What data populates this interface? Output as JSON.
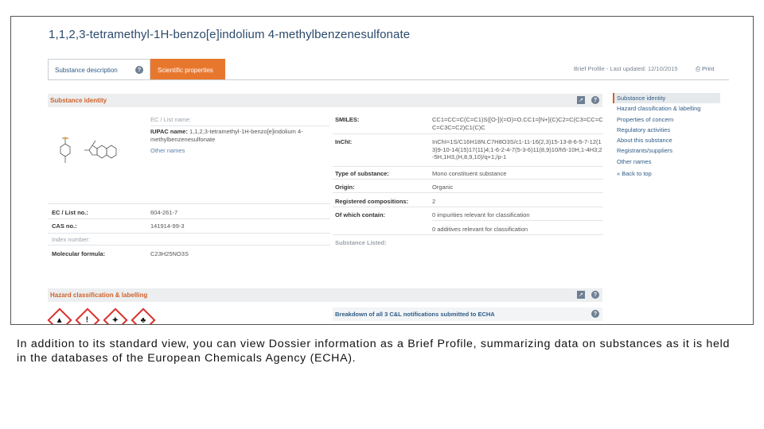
{
  "page": {
    "title": "1,1,2,3-tetramethyl-1H-benzo[e]indolium 4-methylbenzenesulfonate",
    "tabs": [
      {
        "label": "Substance description"
      },
      {
        "label": "Scientific properties"
      }
    ],
    "brief_profile": "Brief Profile - Last updated: 12/10/2015",
    "print_label": "Print"
  },
  "identity": {
    "section_title": "Substance identity",
    "left": {
      "ec_list_name_label": "EC / List name:",
      "iupac_label": "IUPAC name:",
      "iupac_value": "1,1,2,3-tetramethyl-1H-benzo[e]indolium 4-methylbenzenesulfonate",
      "other_names": "Other names",
      "ec_label": "EC / List no.:",
      "ec_value": "604-261-7",
      "cas_label": "CAS no.:",
      "cas_value": "141914-99-3",
      "index_label": "Index number:",
      "formula_label": "Molecular formula:",
      "formula_value": "C23H25NO3S"
    },
    "right": {
      "smiles_label": "SMILES:",
      "smiles_value": "CC1=CC=C(C=C1)S([O-])(=O)=O.CC1=[N+](C)C2=C(C3=CC=CC=C3C=C2)C1(C)C",
      "inchi_label": "InChI:",
      "inchi_value": "InChI=1S/C16H18N.C7H8O3S/c1-11-16(2,3)15-13-8-6-5-7-12(13)9-10-14(15)17(11)4;1-6-2-4-7(5-3-6)11(8,9)10/h5-10H,1-4H3;2-5H,1H3,(H,8,9,10)/q+1;/p-1",
      "type_label": "Type of substance:",
      "type_value": "Mono constituent substance",
      "origin_label": "Origin:",
      "origin_value": "Organic",
      "reg_label": "Registered compositions:",
      "reg_value": "2",
      "which_label": "Of which contain:",
      "which_value_1": "0 impurities relevant for classification",
      "which_value_2": "0 additives relevant for classification",
      "listed_label": "Substance Listed:"
    }
  },
  "sidebar": {
    "items": [
      {
        "label": "Substance identity"
      },
      {
        "label": "Hazard classification & labelling"
      },
      {
        "label": "Properties of concern"
      },
      {
        "label": "Regulatory activities"
      },
      {
        "label": "About this substance"
      },
      {
        "label": "Registrants/suppliers"
      },
      {
        "label": "Other names"
      }
    ],
    "back": "« Back to top"
  },
  "hazard": {
    "section_title": "Hazard classification & labelling",
    "breakdown": "Breakdown of all 3 C&L notifications submitted to ECHA"
  },
  "colors": {
    "accent_orange": "#e8772e",
    "title_blue": "#2b4a6b",
    "hazard_red": "#d9302c"
  },
  "caption": "In addition to its standard view, you can view Dossier information as a Brief Profile, summarizing data on substances as it is held in the databases of the European Chemicals Agency (ECHA)."
}
